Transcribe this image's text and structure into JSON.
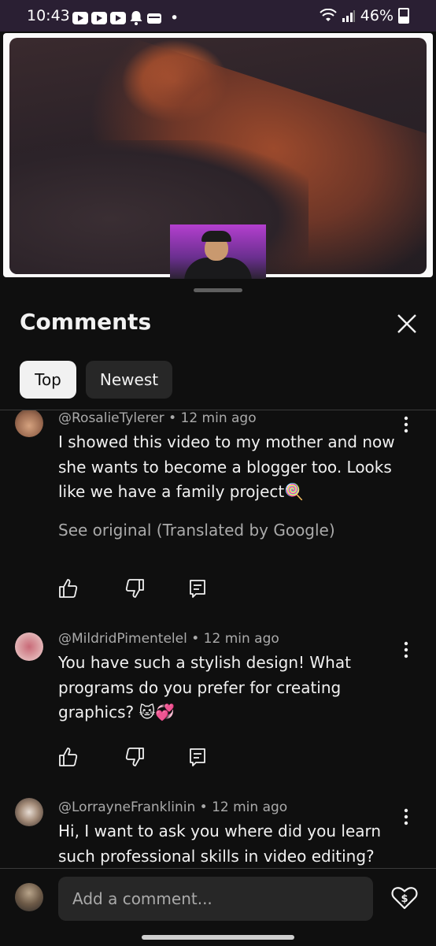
{
  "status_bar": {
    "time": "10:43",
    "battery": "46%",
    "dot": "•"
  },
  "comments_panel": {
    "title": "Comments",
    "close_icon": "close-icon",
    "tabs": [
      {
        "label": "Top",
        "selected": true
      },
      {
        "label": "Newest",
        "selected": false
      }
    ]
  },
  "comments": [
    {
      "meta": "@RosalieTylerer • 12 min ago",
      "text": "I showed this video to my mother and now she wants to become a blogger too. Looks like we have a family project🍭",
      "see_original": "See original (Translated by Google)"
    },
    {
      "meta": "@MildridPimentelel • 12 min ago",
      "text": "You have such a stylish design! What programs do you prefer for creating graphics? 🐱💞"
    },
    {
      "meta": "@LorrayneFranklinin • 12 min ago",
      "text": "Hi, I want to ask you where did you learn such professional skills in video editing? 👄"
    }
  ],
  "composer": {
    "placeholder": "Add a comment..."
  },
  "colors": {
    "background": "#0f0f0f",
    "chip_selected": "#f1f1f1",
    "chip_unselected": "#272727",
    "secondary_text": "#aaaaaa"
  }
}
